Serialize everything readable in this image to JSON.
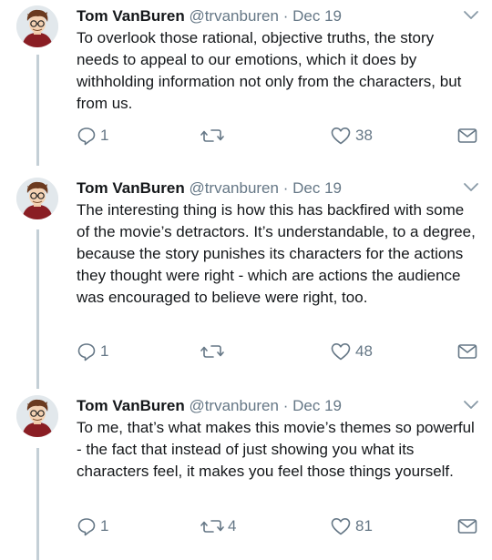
{
  "tweets": [
    {
      "name": "Tom VanBuren",
      "handle": "@trvanburen",
      "separator": "·",
      "date": "Dec 19",
      "text": "To overlook those rational, objective truths, the story needs to appeal to our emotions, which it does by withholding information not only from the characters, but from us.",
      "reply_count": "1",
      "retweet_count": "",
      "like_count": "38"
    },
    {
      "name": "Tom VanBuren",
      "handle": "@trvanburen",
      "separator": "·",
      "date": "Dec 19",
      "text": "The interesting thing is how this has backfired with some of the movie’s detractors. It’s understandable, to a degree, because the story punishes its characters for the actions they thought were right - which are actions the audience was encouraged to believe were right, too.",
      "reply_count": "1",
      "retweet_count": "",
      "like_count": "48"
    },
    {
      "name": "Tom VanBuren",
      "handle": "@trvanburen",
      "separator": "·",
      "date": "Dec 19",
      "text": "To me, that’s what makes this movie’s themes so powerful - the fact that instead of just showing you what its characters feel, it makes you feel those things yourself.",
      "reply_count": "1",
      "retweet_count": "4",
      "like_count": "81"
    }
  ],
  "icons": {
    "reply": "reply-icon",
    "retweet": "retweet-icon",
    "like": "heart-icon",
    "message": "envelope-icon",
    "menu": "chevron-down-icon"
  },
  "colors": {
    "text": "#14171a",
    "secondary": "#657786",
    "thread_line": "#c4cfd6"
  }
}
